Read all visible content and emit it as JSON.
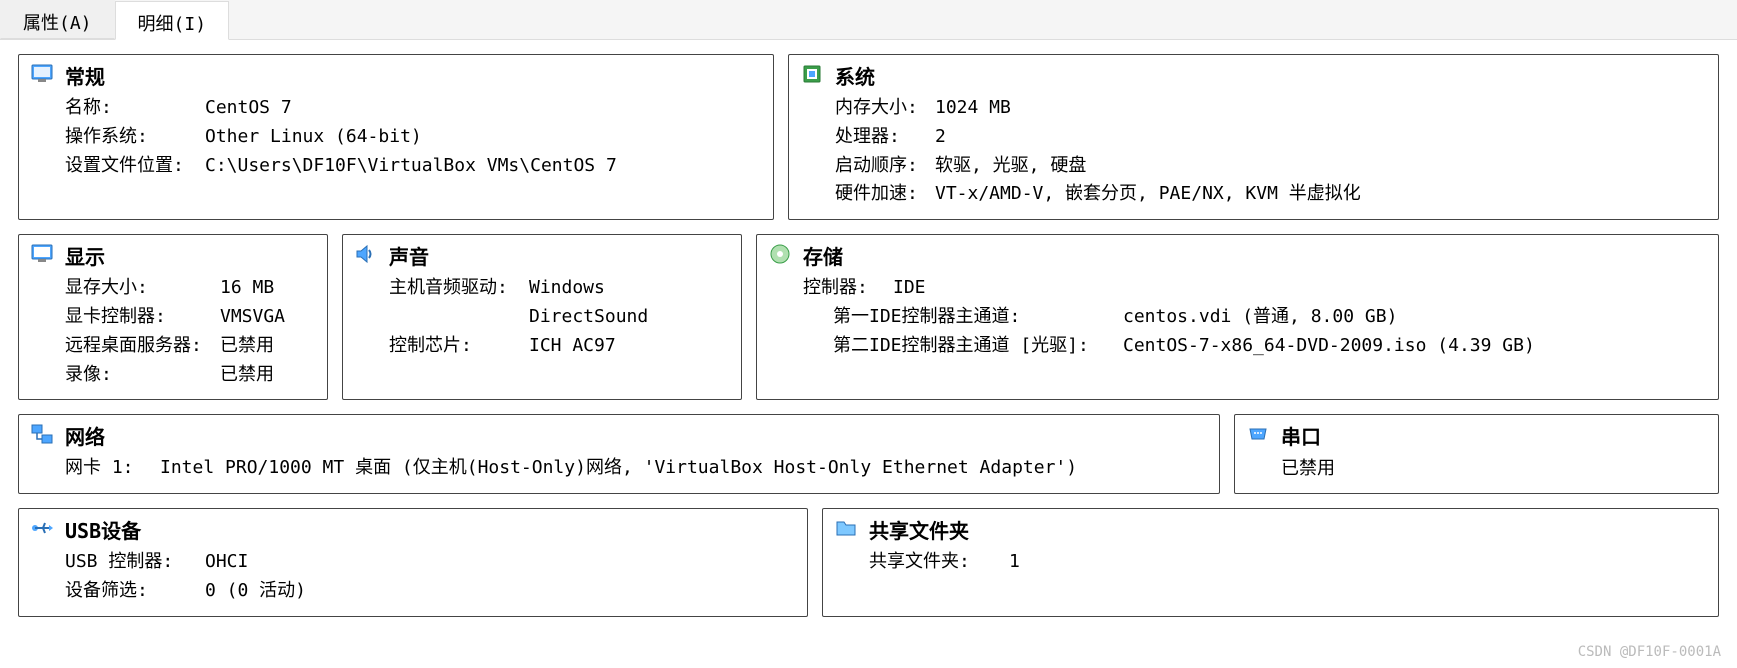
{
  "tabs": {
    "attributes": "属性(A)",
    "details": "明细(I)"
  },
  "general": {
    "title": "常规",
    "name_label": "名称:",
    "name_value": "CentOS 7",
    "os_label": "操作系统:",
    "os_value": "Other Linux (64-bit)",
    "path_label": "设置文件位置:",
    "path_value": "C:\\Users\\DF10F\\VirtualBox VMs\\CentOS 7"
  },
  "system": {
    "title": "系统",
    "mem_label": "内存大小:",
    "mem_value": "1024 MB",
    "cpu_label": "处理器:",
    "cpu_value": "2",
    "boot_label": "启动顺序:",
    "boot_value": "软驱, 光驱, 硬盘",
    "accel_label": "硬件加速:",
    "accel_value": "VT-x/AMD-V, 嵌套分页, PAE/NX, KVM 半虚拟化"
  },
  "display": {
    "title": "显示",
    "vram_label": "显存大小:",
    "vram_value": "16 MB",
    "gpu_label": "显卡控制器:",
    "gpu_value": "VMSVGA",
    "rdp_label": "远程桌面服务器:",
    "rdp_value": "已禁用",
    "rec_label": "录像:",
    "rec_value": "已禁用"
  },
  "audio": {
    "title": "声音",
    "driver_label": "主机音频驱动:",
    "driver_value": "Windows DirectSound",
    "chip_label": "控制芯片:",
    "chip_value": "ICH AC97"
  },
  "storage": {
    "title": "存储",
    "controller_label": "控制器:",
    "controller_value": "IDE",
    "ch1_label": "第一IDE控制器主通道:",
    "ch1_value": "centos.vdi (普通,  8.00  GB)",
    "ch2_label": "第二IDE控制器主通道  [光驱]:",
    "ch2_value": "CentOS-7-x86_64-DVD-2009.iso (4.39  GB)"
  },
  "network": {
    "title": "网络",
    "nic_label": "网卡  1:",
    "nic_value": "Intel PRO/1000 MT 桌面 (仅主机(Host-Only)网络, 'VirtualBox Host-Only Ethernet Adapter')"
  },
  "serial": {
    "title": "串口",
    "status": "已禁用"
  },
  "usb": {
    "title": "USB设备",
    "ctrl_label": "USB  控制器:",
    "ctrl_value": "OHCI",
    "filter_label": "设备筛选:",
    "filter_value": "0 (0 活动)"
  },
  "shared": {
    "title": "共享文件夹",
    "label": "共享文件夹:",
    "value": "1"
  },
  "watermark": "CSDN @DF10F-0001A"
}
